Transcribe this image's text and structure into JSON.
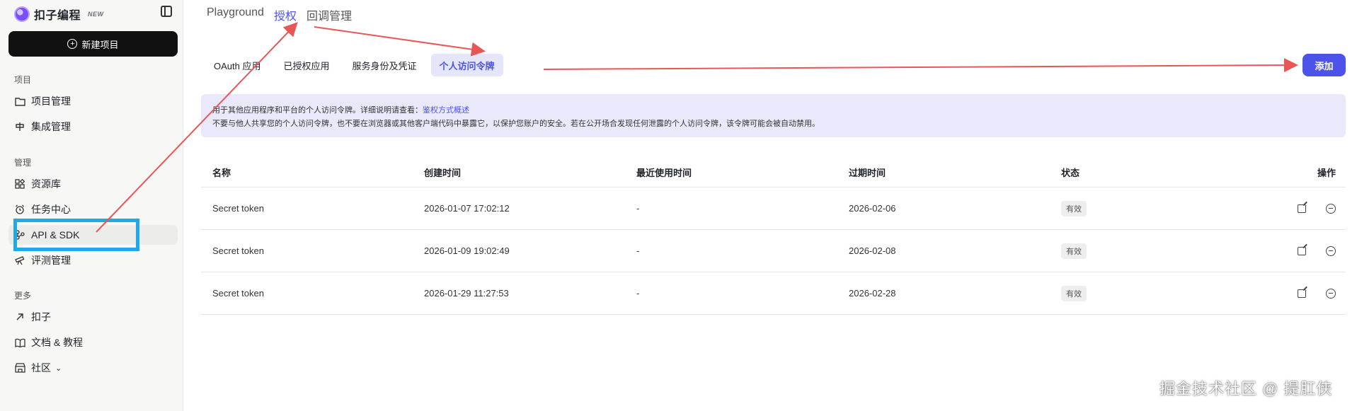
{
  "sidebar": {
    "brand": "扣子编程",
    "brand_badge": "NEW",
    "new_project": "新建项目",
    "sections": {
      "project": "项目",
      "manage": "管理",
      "more": "更多"
    },
    "project_items": [
      {
        "label": "项目管理",
        "icon": "folder-icon"
      },
      {
        "label": "集成管理",
        "icon": "integration-icon"
      }
    ],
    "manage_items": [
      {
        "label": "资源库",
        "icon": "library-icon"
      },
      {
        "label": "任务中心",
        "icon": "alarm-icon"
      },
      {
        "label": "API & SDK",
        "icon": "api-icon"
      },
      {
        "label": "评测管理",
        "icon": "telescope-icon"
      }
    ],
    "more_items": [
      {
        "label": "扣子",
        "icon": "arrow-up-right-icon"
      },
      {
        "label": "文档 & 教程",
        "icon": "book-icon"
      },
      {
        "label": "社区",
        "icon": "community-icon"
      }
    ]
  },
  "top_tabs": [
    "Playground",
    "授权",
    "回调管理"
  ],
  "sub_tabs": [
    "OAuth 应用",
    "已授权应用",
    "服务身份及凭证",
    "个人访问令牌"
  ],
  "add_button": "添加",
  "notice": {
    "line1_prefix": "用于其他应用程序和平台的个人访问令牌。详细说明请查看：",
    "line1_link": "鉴权方式概述",
    "line2": "不要与他人共享您的个人访问令牌，也不要在浏览器或其他客户端代码中暴露它，以保护您账户的安全。若在公开场合发现任何泄露的个人访问令牌，该令牌可能会被自动禁用。"
  },
  "table": {
    "headers": [
      "名称",
      "创建时间",
      "最近使用时间",
      "过期时间",
      "状态",
      "操作"
    ],
    "rows": [
      {
        "name": "Secret token",
        "created": "2026-01-07 17:02:12",
        "last_used": "-",
        "expires": "2026-02-06",
        "status": "有效"
      },
      {
        "name": "Secret token",
        "created": "2026-01-09 19:02:49",
        "last_used": "-",
        "expires": "2026-02-08",
        "status": "有效"
      },
      {
        "name": "Secret token",
        "created": "2026-01-29 11:27:53",
        "last_used": "-",
        "expires": "2026-02-28",
        "status": "有效"
      }
    ]
  },
  "watermark": "掘金技术社区 @ 提肛侠",
  "colors": {
    "accent": "#4d53e8",
    "annotation_arrow": "#e85656",
    "annotation_box": "#1fa9e8"
  }
}
